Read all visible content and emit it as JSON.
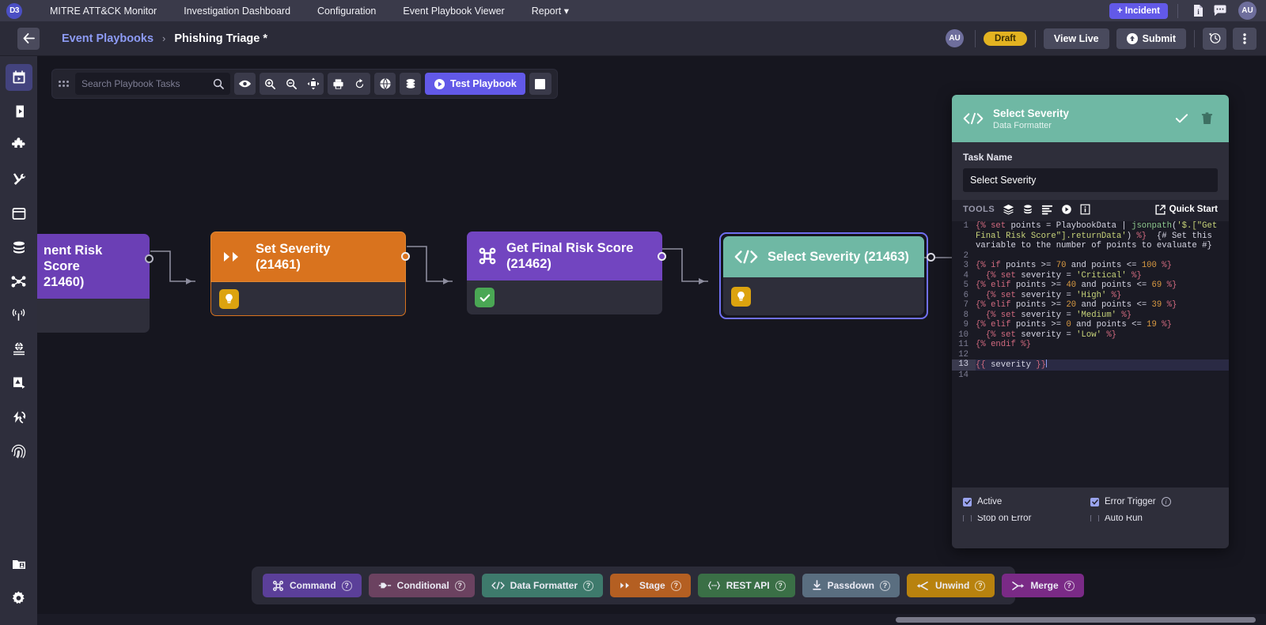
{
  "topnav": {
    "logo": "D3",
    "items": [
      {
        "label": "MITRE ATT&CK Monitor",
        "icon": "none"
      },
      {
        "label": "Investigation Dashboard",
        "icon": "none"
      },
      {
        "label": "Configuration",
        "icon": "none"
      },
      {
        "label": "Event Playbook Viewer",
        "icon": "none"
      },
      {
        "label": "Report ▾",
        "icon": "chevron-down-icon"
      }
    ],
    "incident_button": "+ Incident",
    "doc_icon": "document-icon",
    "chat_icon": "chat-bubble-icon",
    "avatar": "AU"
  },
  "subheader": {
    "back_icon": "back-arrow-icon",
    "breadcrumb_parent": "Event Playbooks",
    "breadcrumb_sep": "›",
    "breadcrumb_current": "Phishing Triage *",
    "avatar": "AU",
    "status_badge": "Draft",
    "view_live": "View Live",
    "submit": "Submit",
    "history_icon": "clock-history-icon",
    "more_icon": "more-vertical-icon"
  },
  "rail": {
    "items": [
      {
        "name": "calendar-play-icon",
        "active": true
      },
      {
        "name": "book-play-icon",
        "active": false
      },
      {
        "name": "puzzle-icon",
        "active": false
      },
      {
        "name": "tools-icon",
        "active": false
      },
      {
        "name": "calendar-icon",
        "active": false
      },
      {
        "name": "database-icon",
        "active": false
      },
      {
        "name": "share-nodes-icon",
        "active": false
      },
      {
        "name": "broadcast-icon",
        "active": false
      },
      {
        "name": "globe-list-icon",
        "active": false
      },
      {
        "name": "incident-report-icon",
        "active": false
      },
      {
        "name": "lightning-sync-icon",
        "active": false
      },
      {
        "name": "fingerprint-icon",
        "active": false
      }
    ],
    "bottom": [
      {
        "name": "folder-user-icon",
        "active": false
      },
      {
        "name": "gear-icon",
        "active": false
      }
    ]
  },
  "toolbar": {
    "grip": "drag-grip-icon",
    "search_placeholder": "Search Playbook Tasks",
    "search_value": "",
    "search_icon": "search-icon",
    "eye_icon": "eye-icon",
    "zoom_in_icon": "zoom-in-icon",
    "zoom_out_icon": "zoom-out-icon",
    "fit_icon": "fit-screen-icon",
    "print_icon": "print-icon",
    "refresh_icon": "refresh-icon",
    "globe_icon": "globe-icon",
    "layers_icon": "layers-icon",
    "test_playbook": "Test Playbook",
    "test_icon": "play-circle-icon",
    "stop_icon": "stop-square-icon"
  },
  "nodes": [
    {
      "title_line1": "nent Risk Score",
      "title_line2": "21460)",
      "color": "#6b3fb5",
      "icon": "partial-node-icon",
      "status_chip": "none",
      "selected": false
    },
    {
      "title_line1": "Set Severity",
      "title_line2": "(21461)",
      "color": "#d9731e",
      "icon": "stage-double-chevron-icon",
      "status_chip": "lightbulb-amber",
      "selected": false
    },
    {
      "title_line1": "Get Final Risk Score",
      "title_line2": "(21462)",
      "color": "#7245c0",
      "icon": "command-icon",
      "status_chip": "check-green",
      "selected": false
    },
    {
      "title_line1": "Select Severity (21463)",
      "title_line2": "",
      "color": "#6fb8a4",
      "icon": "code-brackets-icon",
      "status_chip": "lightbulb-amber",
      "selected": true
    }
  ],
  "panel": {
    "icon": "code-brackets-icon",
    "title": "Select Severity",
    "subtitle": "Data Formatter",
    "accept_icon": "check-icon",
    "delete_icon": "trash-icon",
    "task_name_label": "Task Name",
    "task_name_value": "Select Severity",
    "tools_label": "TOOLS",
    "tool_icons": [
      "layers-stack-icon",
      "database-icon",
      "list-lines-icon",
      "play-circle-icon",
      "info-box-icon"
    ],
    "quick_start": "Quick Start",
    "quick_start_icon": "external-link-icon",
    "code_lines": [
      {
        "n": "1",
        "segments": [
          {
            "t": "{% ",
            "c": "tg"
          },
          {
            "t": "set ",
            "c": "kw"
          },
          {
            "t": "points = PlaybookData | ",
            "c": "var"
          },
          {
            "t": "jsonpath",
            "c": "fn"
          },
          {
            "t": "(",
            "c": "var"
          },
          {
            "t": "'$.[\"Get Final Risk Score\"].returnData'",
            "c": "st"
          },
          {
            "t": ")",
            "c": "var"
          },
          {
            "t": " %}",
            "c": "tg"
          },
          {
            "t": "  {# Set this variable to the number of points to evaluate #}",
            "c": "cm"
          }
        ]
      },
      {
        "n": "2",
        "segments": []
      },
      {
        "n": "3",
        "segments": [
          {
            "t": "{% ",
            "c": "tg"
          },
          {
            "t": "if ",
            "c": "kw"
          },
          {
            "t": "points >= ",
            "c": "var"
          },
          {
            "t": "70",
            "c": "nm"
          },
          {
            "t": " and points <= ",
            "c": "var"
          },
          {
            "t": "100",
            "c": "nm"
          },
          {
            "t": " %}",
            "c": "tg"
          }
        ]
      },
      {
        "n": "4",
        "segments": [
          {
            "t": "  {% ",
            "c": "tg"
          },
          {
            "t": "set ",
            "c": "kw"
          },
          {
            "t": "severity = ",
            "c": "var"
          },
          {
            "t": "'Critical'",
            "c": "st"
          },
          {
            "t": " %}",
            "c": "tg"
          }
        ]
      },
      {
        "n": "5",
        "segments": [
          {
            "t": "{% ",
            "c": "tg"
          },
          {
            "t": "elif ",
            "c": "kw"
          },
          {
            "t": "points >= ",
            "c": "var"
          },
          {
            "t": "40",
            "c": "nm"
          },
          {
            "t": " and points <= ",
            "c": "var"
          },
          {
            "t": "69",
            "c": "nm"
          },
          {
            "t": " %}",
            "c": "tg"
          }
        ]
      },
      {
        "n": "6",
        "segments": [
          {
            "t": "  {% ",
            "c": "tg"
          },
          {
            "t": "set ",
            "c": "kw"
          },
          {
            "t": "severity = ",
            "c": "var"
          },
          {
            "t": "'High'",
            "c": "st"
          },
          {
            "t": " %}",
            "c": "tg"
          }
        ]
      },
      {
        "n": "7",
        "segments": [
          {
            "t": "{% ",
            "c": "tg"
          },
          {
            "t": "elif ",
            "c": "kw"
          },
          {
            "t": "points >= ",
            "c": "var"
          },
          {
            "t": "20",
            "c": "nm"
          },
          {
            "t": " and points <= ",
            "c": "var"
          },
          {
            "t": "39",
            "c": "nm"
          },
          {
            "t": " %}",
            "c": "tg"
          }
        ]
      },
      {
        "n": "8",
        "segments": [
          {
            "t": "  {% ",
            "c": "tg"
          },
          {
            "t": "set ",
            "c": "kw"
          },
          {
            "t": "severity = ",
            "c": "var"
          },
          {
            "t": "'Medium'",
            "c": "st"
          },
          {
            "t": " %}",
            "c": "tg"
          }
        ]
      },
      {
        "n": "9",
        "segments": [
          {
            "t": "{% ",
            "c": "tg"
          },
          {
            "t": "elif ",
            "c": "kw"
          },
          {
            "t": "points >= ",
            "c": "var"
          },
          {
            "t": "0",
            "c": "nm"
          },
          {
            "t": " and points <= ",
            "c": "var"
          },
          {
            "t": "19",
            "c": "nm"
          },
          {
            "t": " %}",
            "c": "tg"
          }
        ]
      },
      {
        "n": "10",
        "segments": [
          {
            "t": "  {% ",
            "c": "tg"
          },
          {
            "t": "set ",
            "c": "kw"
          },
          {
            "t": "severity = ",
            "c": "var"
          },
          {
            "t": "'Low'",
            "c": "st"
          },
          {
            "t": " %}",
            "c": "tg"
          }
        ]
      },
      {
        "n": "11",
        "segments": [
          {
            "t": "{% ",
            "c": "tg"
          },
          {
            "t": "endif",
            "c": "kw"
          },
          {
            "t": " %}",
            "c": "tg"
          }
        ]
      },
      {
        "n": "12",
        "segments": []
      },
      {
        "n": "13",
        "current": true,
        "segments": [
          {
            "t": "{{ ",
            "c": "tg"
          },
          {
            "t": "severity",
            "c": "var"
          },
          {
            "t": " }}",
            "c": "tg"
          }
        ]
      },
      {
        "n": "14",
        "segments": []
      }
    ],
    "checkboxes": [
      {
        "label": "Active",
        "checked": true,
        "info": false
      },
      {
        "label": "Error Trigger",
        "checked": true,
        "info": true
      },
      {
        "label": "Stop on Error",
        "checked": false,
        "info": false
      },
      {
        "label": "Auto Run",
        "checked": false,
        "info": false
      }
    ]
  },
  "palette": [
    {
      "label": "Command",
      "color": "#5b3f99",
      "icon": "command-icon",
      "help": "?"
    },
    {
      "label": "Conditional",
      "color": "#6b4260",
      "icon": "conditional-icon",
      "help": "?"
    },
    {
      "label": "Data Formatter",
      "color": "#3e7a6c",
      "icon": "code-brackets-icon",
      "help": "?"
    },
    {
      "label": "Stage",
      "color": "#b45f22",
      "icon": "stage-double-chevron-icon",
      "help": "?"
    },
    {
      "label": "REST API",
      "color": "#3a6f46",
      "icon": "rest-api-icon",
      "help": "?"
    },
    {
      "label": "Passdown",
      "color": "#5a6e80",
      "icon": "download-icon",
      "help": "?"
    },
    {
      "label": "Unwind",
      "color": "#b8820e",
      "icon": "unwind-icon",
      "help": "?"
    },
    {
      "label": "Merge",
      "color": "#7a2a86",
      "icon": "merge-icon",
      "help": "?"
    }
  ],
  "colors": {
    "accent": "#6259e8",
    "draft": "#e3b321",
    "teal": "#6fb8a4",
    "orange": "#d9731e",
    "purple": "#7245c0"
  }
}
